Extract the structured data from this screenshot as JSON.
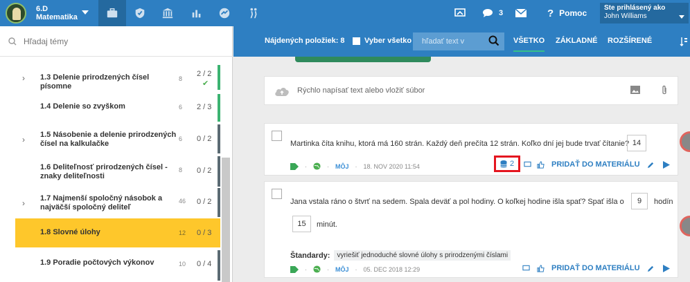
{
  "header": {
    "class_line1": "6.D",
    "class_line2": "Matematika",
    "messages_count": "3",
    "help_label": "Pomoc",
    "user_line1": "Ste prihlásený ako",
    "user_line2": "John Williams"
  },
  "left": {
    "search_placeholder": "Hľadaj témy",
    "topics": [
      {
        "title": "1.3 Delenie prirodzených čísel písomne",
        "count": "8",
        "fraction": "2 / 2",
        "has_children": true,
        "completed": true
      },
      {
        "title": "1.4 Delenie so zvyškom",
        "count": "6",
        "fraction": "2 / 3",
        "has_children": false
      },
      {
        "title": "1.5 Násobenie a delenie prirodzených čísel na kalkulačke",
        "count": "6",
        "fraction": "0 / 2",
        "has_children": true
      },
      {
        "title": "1.6 Deliteľnosť prirodzených čísel - znaky deliteľnosti",
        "count": "8",
        "fraction": "0 / 2",
        "has_children": false
      },
      {
        "title": "1.7 Najmenší spoločný násobok a najväčší spoločný deliteľ",
        "count": "46",
        "fraction": "0 / 2",
        "has_children": true
      },
      {
        "title": "1.8 Slovné úlohy",
        "count": "12",
        "fraction": "0 / 3",
        "has_children": false,
        "selected": true
      },
      {
        "title": "1.9 Poradie počtových výkonov",
        "count": "10",
        "fraction": "0 / 4",
        "has_children": false
      }
    ]
  },
  "toolbar": {
    "found_label": "Nájdených položiek: 8",
    "select_all": "Vyber všetko",
    "search_placeholder": "hľadať text v",
    "tabs": [
      "VŠETKO",
      "ZÁKLADNÉ",
      "ROZŠÍRENÉ"
    ]
  },
  "quick_input": {
    "placeholder": "Rýchlo napísať text alebo vložiť súbor"
  },
  "cards": [
    {
      "question": "Martinka číta knihu, ktorá má 160 strán. Každý deň prečíta 12 strán. Koľko dní jej bude trvať čítanie?",
      "answer": "14",
      "author": "MÔJ",
      "date": "18. NOV 2020 11:54",
      "db_count": "2",
      "add_label": "PRIDAŤ DO MATERIÁLU"
    },
    {
      "question_part1": "Jana vstala ráno o štvrť na sedem. Spala deväť a pol hodiny. O koľkej hodine išla spať? Spať išla o",
      "answer1": "9",
      "unit1": "hodín",
      "answer2": "15",
      "unit2": "minút.",
      "standards_label": "Štandardy:",
      "standard": "vyriešiť jednoduché slovné úlohy s prirodzenými číslami",
      "author": "MÔJ",
      "date": "05. DEC 2018 12:29",
      "add_label": "PRIDAŤ DO MATERIÁLU"
    }
  ]
}
